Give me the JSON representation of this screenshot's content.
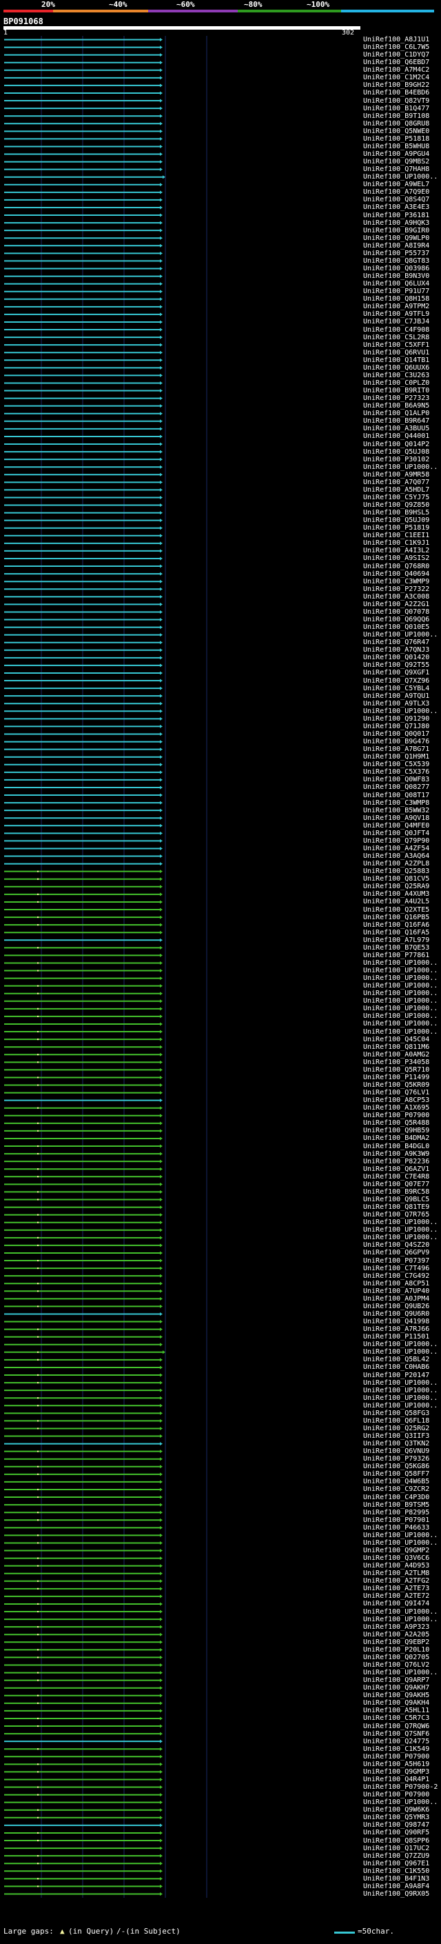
{
  "legend": {
    "items": [
      {
        "label": "20%",
        "color": "#e8252a"
      },
      {
        "label": "~40%",
        "color": "#e9862c"
      },
      {
        "label": "~60%",
        "color": "#8e3bb4"
      },
      {
        "label": "~80%",
        "color": "#2e9a1f"
      },
      {
        "label": "~100%",
        "color": "#24b4e4"
      }
    ]
  },
  "query": {
    "id": "BP091068",
    "start": "1",
    "end": "302"
  },
  "colors": {
    "blue": "#37c8d4",
    "green": "#44c22c",
    "gap": "#f5f5a0",
    "gridline": "#1a2a66"
  },
  "hits": [
    {
      "label": "UniRef100_A8J1U1",
      "color": "blue"
    },
    {
      "label": "UniRef100_C6L7W5",
      "color": "blue"
    },
    {
      "label": "UniRef100_C1DYQ7",
      "color": "blue"
    },
    {
      "label": "UniRef100_Q6EBD7",
      "color": "blue"
    },
    {
      "label": "UniRef100_A7M4C2",
      "color": "blue"
    },
    {
      "label": "UniRef100_C1M2C4",
      "color": "blue"
    },
    {
      "label": "UniRef100_B9GH22",
      "color": "blue"
    },
    {
      "label": "UniRef100_B4EBD6",
      "color": "blue"
    },
    {
      "label": "UniRef100_Q82VT9",
      "color": "blue"
    },
    {
      "label": "UniRef100_B1Q477",
      "color": "blue"
    },
    {
      "label": "UniRef100_B9T108",
      "color": "blue"
    },
    {
      "label": "UniRef100_Q8GRU8",
      "color": "blue"
    },
    {
      "label": "UniRef100_Q5NWE0",
      "color": "blue"
    },
    {
      "label": "UniRef100_P51818",
      "color": "blue"
    },
    {
      "label": "UniRef100_B5WHU8",
      "color": "blue"
    },
    {
      "label": "UniRef100_A9PGU4",
      "color": "blue"
    },
    {
      "label": "UniRef100_Q9MBS2",
      "color": "blue"
    },
    {
      "label": "UniRef100_Q7HAH8",
      "color": "blue"
    },
    {
      "label": "UniRef100_UP1000..",
      "color": "blue"
    },
    {
      "label": "UniRef100_A9WEL7",
      "color": "blue"
    },
    {
      "label": "UniRef100_A7Q9E0",
      "color": "blue"
    },
    {
      "label": "UniRef100_Q8S4Q7",
      "color": "blue"
    },
    {
      "label": "UniRef100_A3E4E3",
      "color": "blue"
    },
    {
      "label": "UniRef100_P36181",
      "color": "blue"
    },
    {
      "label": "UniRef100_A9HQK3",
      "color": "blue"
    },
    {
      "label": "UniRef100_B9GIR0",
      "color": "blue"
    },
    {
      "label": "UniRef100_Q9WLP0",
      "color": "blue"
    },
    {
      "label": "UniRef100_A8I9R4",
      "color": "blue"
    },
    {
      "label": "UniRef100_P55737",
      "color": "blue"
    },
    {
      "label": "UniRef100_Q8GT83",
      "color": "blue"
    },
    {
      "label": "UniRef100_Q03986",
      "color": "blue"
    },
    {
      "label": "UniRef100_B9N3V0",
      "color": "blue"
    },
    {
      "label": "UniRef100_Q6LUX4",
      "color": "blue"
    },
    {
      "label": "UniRef100_P91U77",
      "color": "blue"
    },
    {
      "label": "UniRef100_Q8H158",
      "color": "blue"
    },
    {
      "label": "UniRef100_A9TPM2",
      "color": "blue"
    },
    {
      "label": "UniRef100_A9TFL9",
      "color": "blue"
    },
    {
      "label": "UniRef100_C7JBJ4",
      "color": "blue"
    },
    {
      "label": "UniRef100_C4F908",
      "color": "blue"
    },
    {
      "label": "UniRef100_C5L2R8",
      "color": "blue"
    },
    {
      "label": "UniRef100_C5XFF1",
      "color": "blue"
    },
    {
      "label": "UniRef100_Q6RVU1",
      "color": "blue"
    },
    {
      "label": "UniRef100_Q14TB1",
      "color": "blue"
    },
    {
      "label": "UniRef100_Q6UUX6",
      "color": "blue"
    },
    {
      "label": "UniRef100_C3U263",
      "color": "blue"
    },
    {
      "label": "UniRef100_C0PLZ0",
      "color": "blue"
    },
    {
      "label": "UniRef100_B9RIT0",
      "color": "blue"
    },
    {
      "label": "UniRef100_P27323",
      "color": "blue"
    },
    {
      "label": "UniRef100_B6A9N5",
      "color": "blue"
    },
    {
      "label": "UniRef100_Q1ALP0",
      "color": "blue"
    },
    {
      "label": "UniRef100_B9R647",
      "color": "blue"
    },
    {
      "label": "UniRef100_A3BUU5",
      "color": "blue"
    },
    {
      "label": "UniRef100_Q44001",
      "color": "blue"
    },
    {
      "label": "UniRef100_Q014P2",
      "color": "blue"
    },
    {
      "label": "UniRef100_Q5UJ08",
      "color": "blue"
    },
    {
      "label": "UniRef100_P30102",
      "color": "blue"
    },
    {
      "label": "UniRef100_UP1000..",
      "color": "blue"
    },
    {
      "label": "UniRef100_A9MR58",
      "color": "blue"
    },
    {
      "label": "UniRef100_A7Q077",
      "color": "blue"
    },
    {
      "label": "UniRef100_A5HDL7",
      "color": "blue"
    },
    {
      "label": "UniRef100_C5YJ75",
      "color": "blue"
    },
    {
      "label": "UniRef100_Q9Z850",
      "color": "blue"
    },
    {
      "label": "UniRef100_B9HSL5",
      "color": "blue"
    },
    {
      "label": "UniRef100_Q5UJ09",
      "color": "blue"
    },
    {
      "label": "UniRef100_P51819",
      "color": "blue"
    },
    {
      "label": "UniRef100_C1EEI1",
      "color": "blue"
    },
    {
      "label": "UniRef100_C1K9J1",
      "color": "blue"
    },
    {
      "label": "UniRef100_A4I3L2",
      "color": "blue"
    },
    {
      "label": "UniRef100_A9SIS2",
      "color": "blue"
    },
    {
      "label": "UniRef100_Q768R0",
      "color": "blue"
    },
    {
      "label": "UniRef100_Q40694",
      "color": "blue"
    },
    {
      "label": "UniRef100_C3WMP9",
      "color": "blue"
    },
    {
      "label": "UniRef100_P27322",
      "color": "blue"
    },
    {
      "label": "UniRef100_A3C008",
      "color": "blue"
    },
    {
      "label": "UniRef100_A2Z2G1",
      "color": "blue"
    },
    {
      "label": "UniRef100_Q07078",
      "color": "blue"
    },
    {
      "label": "UniRef100_Q69QQ6",
      "color": "blue"
    },
    {
      "label": "UniRef100_Q010E5",
      "color": "blue"
    },
    {
      "label": "UniRef100_UP1000..",
      "color": "blue"
    },
    {
      "label": "UniRef100_Q76R47",
      "color": "blue"
    },
    {
      "label": "UniRef100_A7QNJ3",
      "color": "blue"
    },
    {
      "label": "UniRef100_Q01420",
      "color": "blue"
    },
    {
      "label": "UniRef100_Q92T55",
      "color": "blue"
    },
    {
      "label": "UniRef100_Q9XGF1",
      "color": "blue"
    },
    {
      "label": "UniRef100_Q7XZ96",
      "color": "blue"
    },
    {
      "label": "UniRef100_C5YBL4",
      "color": "blue"
    },
    {
      "label": "UniRef100_A9TQU1",
      "color": "blue"
    },
    {
      "label": "UniRef100_A9TLX3",
      "color": "blue"
    },
    {
      "label": "UniRef100_UP1000..",
      "color": "blue"
    },
    {
      "label": "UniRef100_Q91290",
      "color": "blue"
    },
    {
      "label": "UniRef100_Q71J80",
      "color": "blue"
    },
    {
      "label": "UniRef100_Q0Q017",
      "color": "blue"
    },
    {
      "label": "UniRef100_B9G476",
      "color": "blue"
    },
    {
      "label": "UniRef100_A7BG71",
      "color": "blue"
    },
    {
      "label": "UniRef100_Q1H9M1",
      "color": "blue"
    },
    {
      "label": "UniRef100_C5X539",
      "color": "blue"
    },
    {
      "label": "UniRef100_C5X376",
      "color": "blue"
    },
    {
      "label": "UniRef100_Q0WF83",
      "color": "blue"
    },
    {
      "label": "UniRef100_Q08277",
      "color": "blue"
    },
    {
      "label": "UniRef100_Q08T17",
      "color": "blue"
    },
    {
      "label": "UniRef100_C3WMP8",
      "color": "blue"
    },
    {
      "label": "UniRef100_B5WW32",
      "color": "blue"
    },
    {
      "label": "UniRef100_A9QV18",
      "color": "blue"
    },
    {
      "label": "UniRef100_Q4MFE0",
      "color": "blue"
    },
    {
      "label": "UniRef100_Q0JFT4",
      "color": "blue"
    },
    {
      "label": "UniRef100_Q79P90",
      "color": "blue"
    },
    {
      "label": "UniRef100_A4ZF54",
      "color": "blue"
    },
    {
      "label": "UniRef100_A3AQ64",
      "color": "blue"
    },
    {
      "label": "UniRef100_A2ZPL8",
      "color": "blue"
    },
    {
      "label": "UniRef100_Q25883",
      "color": "green"
    },
    {
      "label": "UniRef100_Q81CV5",
      "color": "green"
    },
    {
      "label": "UniRef100_Q25RA9",
      "color": "green"
    },
    {
      "label": "UniRef100_A4XUM3",
      "color": "green"
    },
    {
      "label": "UniRef100_A4U2L5",
      "color": "green"
    },
    {
      "label": "UniRef100_Q2XTE5",
      "color": "green"
    },
    {
      "label": "UniRef100_Q16PB5",
      "color": "green"
    },
    {
      "label": "UniRef100_Q16FA6",
      "color": "green"
    },
    {
      "label": "UniRef100_Q16FA5",
      "color": "green"
    },
    {
      "label": "UniRef100_A7L979",
      "color": "blue"
    },
    {
      "label": "UniRef100_B7QE53",
      "color": "green"
    },
    {
      "label": "UniRef100_P77861",
      "color": "green"
    },
    {
      "label": "UniRef100_UP1000..",
      "color": "green"
    },
    {
      "label": "UniRef100_UP1000..",
      "color": "green"
    },
    {
      "label": "UniRef100_UP1000..",
      "color": "green"
    },
    {
      "label": "UniRef100_UP1000..",
      "color": "green"
    },
    {
      "label": "UniRef100_UP1000..",
      "color": "green"
    },
    {
      "label": "UniRef100_UP1000..",
      "color": "green"
    },
    {
      "label": "UniRef100_UP1000..",
      "color": "green"
    },
    {
      "label": "UniRef100_UP1000..",
      "color": "green"
    },
    {
      "label": "UniRef100_UP1000..",
      "color": "green"
    },
    {
      "label": "UniRef100_UP1000..",
      "color": "green"
    },
    {
      "label": "UniRef100_Q45C04",
      "color": "green"
    },
    {
      "label": "UniRef100_Q811M6",
      "color": "green"
    },
    {
      "label": "UniRef100_A0AMG2",
      "color": "green"
    },
    {
      "label": "UniRef100_P34058",
      "color": "green"
    },
    {
      "label": "UniRef100_Q5R710",
      "color": "green"
    },
    {
      "label": "UniRef100_P11499",
      "color": "green"
    },
    {
      "label": "UniRef100_Q5KR09",
      "color": "green"
    },
    {
      "label": "UniRef100_Q76LV1",
      "color": "green"
    },
    {
      "label": "UniRef100_A8CP53",
      "color": "blue"
    },
    {
      "label": "UniRef100_A1X695",
      "color": "green"
    },
    {
      "label": "UniRef100_P07900",
      "color": "green"
    },
    {
      "label": "UniRef100_Q5R488",
      "color": "green"
    },
    {
      "label": "UniRef100_Q9HB59",
      "color": "green"
    },
    {
      "label": "UniRef100_B4DMA2",
      "color": "green"
    },
    {
      "label": "UniRef100_B4DGL0",
      "color": "green"
    },
    {
      "label": "UniRef100_A9K3W9",
      "color": "green"
    },
    {
      "label": "UniRef100_P82236",
      "color": "green"
    },
    {
      "label": "UniRef100_Q6AZV1",
      "color": "green"
    },
    {
      "label": "UniRef100_C7E4R8",
      "color": "green"
    },
    {
      "label": "UniRef100_Q07E77",
      "color": "green"
    },
    {
      "label": "UniRef100_B9RC58",
      "color": "green"
    },
    {
      "label": "UniRef100_Q9BLC5",
      "color": "green"
    },
    {
      "label": "UniRef100_Q81TE9",
      "color": "green"
    },
    {
      "label": "UniRef100_Q7R765",
      "color": "green"
    },
    {
      "label": "UniRef100_UP1000..",
      "color": "green"
    },
    {
      "label": "UniRef100_UP1000..",
      "color": "green"
    },
    {
      "label": "UniRef100_UP1000..",
      "color": "green"
    },
    {
      "label": "UniRef100_Q4SZ20",
      "color": "green"
    },
    {
      "label": "UniRef100_Q6GPV9",
      "color": "green"
    },
    {
      "label": "UniRef100_P07397",
      "color": "green"
    },
    {
      "label": "UniRef100_C7T496",
      "color": "green"
    },
    {
      "label": "UniRef100_C7G492",
      "color": "green"
    },
    {
      "label": "UniRef100_A8CP51",
      "color": "green"
    },
    {
      "label": "UniRef100_A7UP40",
      "color": "green"
    },
    {
      "label": "UniRef100_A0JPM4",
      "color": "green"
    },
    {
      "label": "UniRef100_Q9UB26",
      "color": "green"
    },
    {
      "label": "UniRef100_Q9U6R0",
      "color": "blue"
    },
    {
      "label": "UniRef100_Q41998",
      "color": "green"
    },
    {
      "label": "UniRef100_A7RJ66",
      "color": "green"
    },
    {
      "label": "UniRef100_P11501",
      "color": "green"
    },
    {
      "label": "UniRef100_UP1000..",
      "color": "green"
    },
    {
      "label": "UniRef100_UP1000..",
      "color": "green"
    },
    {
      "label": "UniRef100_Q5BL42",
      "color": "green"
    },
    {
      "label": "UniRef100_C0HAB6",
      "color": "green"
    },
    {
      "label": "UniRef100_P20147",
      "color": "green"
    },
    {
      "label": "UniRef100_UP1000..",
      "color": "green"
    },
    {
      "label": "UniRef100_UP1000..",
      "color": "green"
    },
    {
      "label": "UniRef100_UP1000..",
      "color": "green"
    },
    {
      "label": "UniRef100_UP1000..",
      "color": "green"
    },
    {
      "label": "UniRef100_Q58FG3",
      "color": "green"
    },
    {
      "label": "UniRef100_Q6FL18",
      "color": "green"
    },
    {
      "label": "UniRef100_Q25RG2",
      "color": "green"
    },
    {
      "label": "UniRef100_Q3IIF3",
      "color": "green"
    },
    {
      "label": "UniRef100_Q3TKN2",
      "color": "blue"
    },
    {
      "label": "UniRef100_Q6VNU9",
      "color": "green"
    },
    {
      "label": "UniRef100_P79326",
      "color": "green"
    },
    {
      "label": "UniRef100_Q5KG86",
      "color": "green"
    },
    {
      "label": "UniRef100_Q58FF7",
      "color": "green"
    },
    {
      "label": "UniRef100_Q4W6B5",
      "color": "green"
    },
    {
      "label": "UniRef100_C9ZCR2",
      "color": "green"
    },
    {
      "label": "UniRef100_C4P3D0",
      "color": "green"
    },
    {
      "label": "UniRef100_B9TSM5",
      "color": "green"
    },
    {
      "label": "UniRef100_P82995",
      "color": "green"
    },
    {
      "label": "UniRef100_P07901",
      "color": "green"
    },
    {
      "label": "UniRef100_P46633",
      "color": "green"
    },
    {
      "label": "UniRef100_UP1000..",
      "color": "green"
    },
    {
      "label": "UniRef100_UP1000..",
      "color": "green"
    },
    {
      "label": "UniRef100_Q9GMP2",
      "color": "green"
    },
    {
      "label": "UniRef100_Q3V6C6",
      "color": "green"
    },
    {
      "label": "UniRef100_A4D953",
      "color": "green"
    },
    {
      "label": "UniRef100_A2TLM8",
      "color": "green"
    },
    {
      "label": "UniRef100_A2TFG2",
      "color": "green"
    },
    {
      "label": "UniRef100_A2TE73",
      "color": "green"
    },
    {
      "label": "UniRef100_A2TE72",
      "color": "green"
    },
    {
      "label": "UniRef100_Q9I474",
      "color": "green"
    },
    {
      "label": "UniRef100_UP1000..",
      "color": "green"
    },
    {
      "label": "UniRef100_UP1000..",
      "color": "green"
    },
    {
      "label": "UniRef100_A9P323",
      "color": "green"
    },
    {
      "label": "UniRef100_A2A205",
      "color": "green"
    },
    {
      "label": "UniRef100_Q9EBP2",
      "color": "green"
    },
    {
      "label": "UniRef100_P20L10",
      "color": "green"
    },
    {
      "label": "UniRef100_Q02705",
      "color": "green"
    },
    {
      "label": "UniRef100_Q76LV2",
      "color": "green"
    },
    {
      "label": "UniRef100_UP1000..",
      "color": "green"
    },
    {
      "label": "UniRef100_Q9ARP7",
      "color": "green"
    },
    {
      "label": "UniRef100_Q9AKH7",
      "color": "green"
    },
    {
      "label": "UniRef100_Q9AKH5",
      "color": "green"
    },
    {
      "label": "UniRef100_Q9AKH4",
      "color": "green"
    },
    {
      "label": "UniRef100_A5HL11",
      "color": "green"
    },
    {
      "label": "UniRef100_C5R7C3",
      "color": "green"
    },
    {
      "label": "UniRef100_Q7RQW6",
      "color": "green"
    },
    {
      "label": "UniRef100_Q7SNF6",
      "color": "green"
    },
    {
      "label": "UniRef100_Q24775",
      "color": "blue"
    },
    {
      "label": "UniRef100_C1K549",
      "color": "green"
    },
    {
      "label": "UniRef100_P07900",
      "color": "green"
    },
    {
      "label": "UniRef100_A5H619",
      "color": "green"
    },
    {
      "label": "UniRef100_Q9GMP3",
      "color": "green"
    },
    {
      "label": "UniRef100_Q4R4P1",
      "color": "green"
    },
    {
      "label": "UniRef100_P07900-2",
      "color": "green"
    },
    {
      "label": "UniRef100_P07900",
      "color": "green"
    },
    {
      "label": "UniRef100_UP1000..",
      "color": "green"
    },
    {
      "label": "UniRef100_Q9W6K6",
      "color": "green"
    },
    {
      "label": "UniRef100_Q5YMR3",
      "color": "green"
    },
    {
      "label": "UniRef100_Q98747",
      "color": "blue"
    },
    {
      "label": "UniRef100_Q90RF5",
      "color": "green"
    },
    {
      "label": "UniRef100_Q8SPP6",
      "color": "green"
    },
    {
      "label": "UniRef100_Q17UC2",
      "color": "green"
    },
    {
      "label": "UniRef100_Q7ZZU9",
      "color": "green"
    },
    {
      "label": "UniRef100_Q967E1",
      "color": "green"
    },
    {
      "label": "UniRef100_C1K550",
      "color": "green"
    },
    {
      "label": "UniRef100_B4F1N3",
      "color": "green"
    },
    {
      "label": "UniRef100_A9A8F4",
      "color": "green"
    },
    {
      "label": "UniRef100_Q9RX05",
      "color": "green"
    }
  ],
  "long_hits": [
    {
      "label": "UniRef100_UP1000..",
      "index": 18
    },
    {
      "label": "UniRef100_Q9U6R0",
      "index": 172
    }
  ],
  "footer": {
    "large_gaps_label": "Large gaps:",
    "query_gap_legend": "(in Query)",
    "subject_gap_legend": "/-(in Subject)",
    "scale_label": "=50char."
  }
}
